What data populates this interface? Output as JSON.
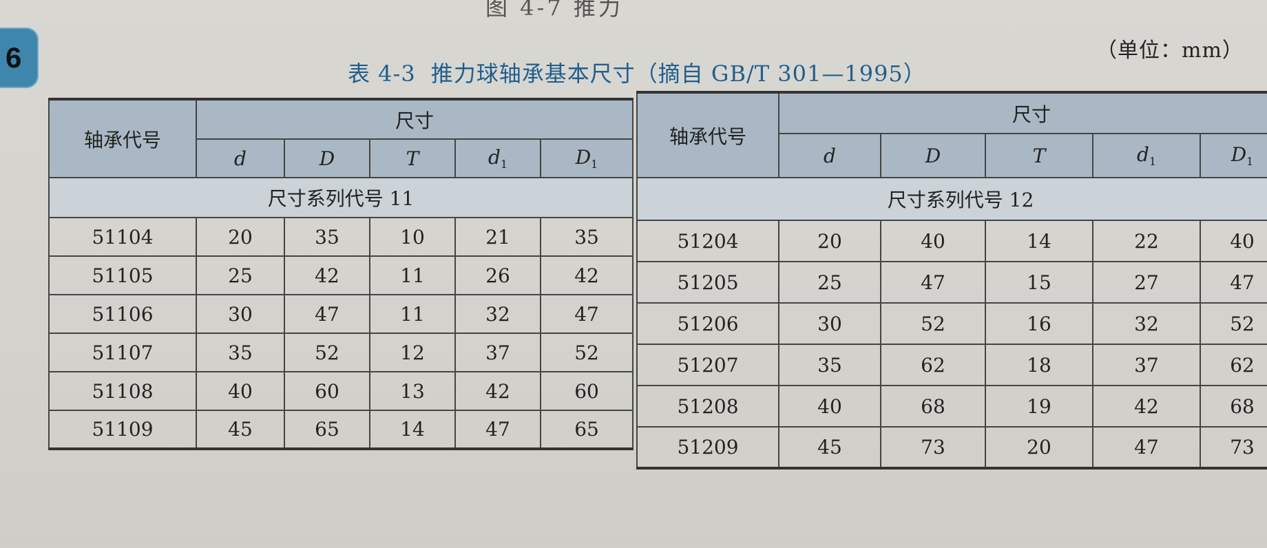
{
  "top_fragment": "图 4-7 推力",
  "page_tab": "6",
  "title": {
    "number": "表 4-3",
    "text": "推力球轴承基本尺寸（摘自 GB/T 301—1995）"
  },
  "unit_note": "（单位：mm）",
  "tables": [
    {
      "header_code": "轴承代号",
      "header_group": "尺寸",
      "columns": [
        {
          "base": "d",
          "sub": ""
        },
        {
          "base": "D",
          "sub": ""
        },
        {
          "base": "T",
          "sub": ""
        },
        {
          "base": "d",
          "sub": "1"
        },
        {
          "base": "D",
          "sub": "1"
        }
      ],
      "series_label": "尺寸系列代号 11",
      "rows": [
        {
          "code": "51104",
          "values": [
            "20",
            "35",
            "10",
            "21",
            "35"
          ]
        },
        {
          "code": "51105",
          "values": [
            "25",
            "42",
            "11",
            "26",
            "42"
          ]
        },
        {
          "code": "51106",
          "values": [
            "30",
            "47",
            "11",
            "32",
            "47"
          ]
        },
        {
          "code": "51107",
          "values": [
            "35",
            "52",
            "12",
            "37",
            "52"
          ]
        },
        {
          "code": "51108",
          "values": [
            "40",
            "60",
            "13",
            "42",
            "60"
          ]
        },
        {
          "code": "51109",
          "values": [
            "45",
            "65",
            "14",
            "47",
            "65"
          ]
        }
      ]
    },
    {
      "header_code": "轴承代号",
      "header_group": "尺寸",
      "columns": [
        {
          "base": "d",
          "sub": ""
        },
        {
          "base": "D",
          "sub": ""
        },
        {
          "base": "T",
          "sub": ""
        },
        {
          "base": "d",
          "sub": "1"
        },
        {
          "base": "D",
          "sub": "1"
        }
      ],
      "series_label": "尺寸系列代号 12",
      "rows": [
        {
          "code": "51204",
          "values": [
            "20",
            "40",
            "14",
            "22",
            "40"
          ]
        },
        {
          "code": "51205",
          "values": [
            "25",
            "47",
            "15",
            "27",
            "47"
          ]
        },
        {
          "code": "51206",
          "values": [
            "30",
            "52",
            "16",
            "32",
            "52"
          ]
        },
        {
          "code": "51207",
          "values": [
            "35",
            "62",
            "18",
            "37",
            "62"
          ]
        },
        {
          "code": "51208",
          "values": [
            "40",
            "68",
            "19",
            "42",
            "68"
          ]
        },
        {
          "code": "51209",
          "values": [
            "45",
            "73",
            "20",
            "47",
            "73"
          ]
        }
      ]
    }
  ]
}
